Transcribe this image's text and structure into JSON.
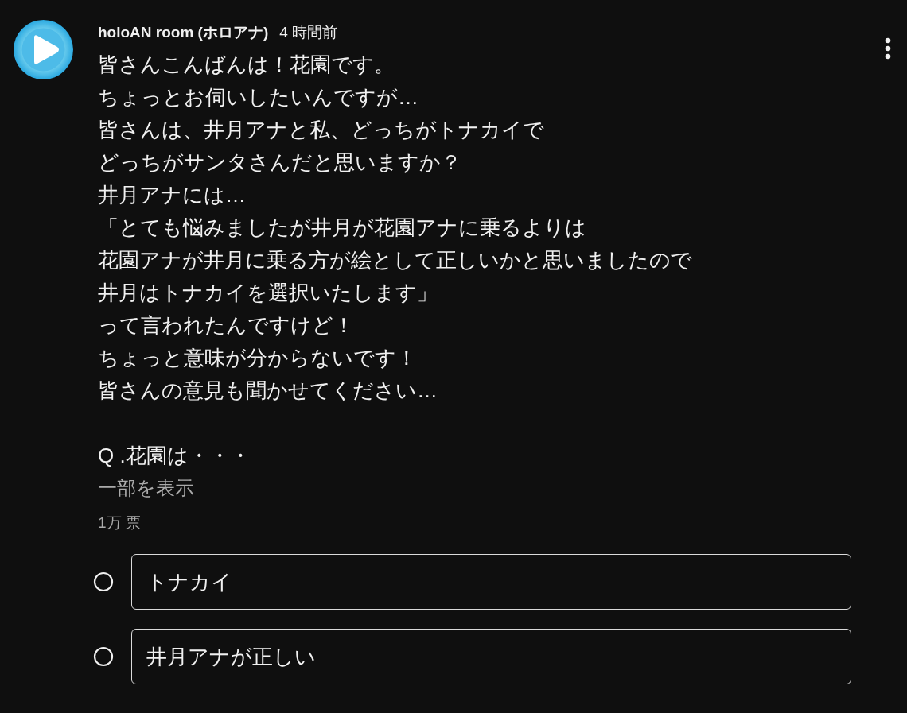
{
  "post": {
    "author": "holoAN room (ホロアナ)",
    "time": "4 時間前",
    "body": [
      "皆さんこんばんは！花園です。",
      "ちょっとお伺いしたいんですが…",
      "皆さんは、井月アナと私、どっちがトナカイで",
      "どっちがサンタさんだと思いますか？",
      "井月アナには…",
      "「とても悩みましたが井月が花園アナに乗るよりは",
      "花園アナが井月に乗る方が絵として正しいかと思いましたので",
      "井月はトナカイを選択いたします」",
      "って言われたんですけど！",
      "ちょっと意味が分からないです！",
      "皆さんの意見も聞かせてください…"
    ],
    "question": "Q .花園は・・・",
    "show_more": "一部を表示",
    "votes": "1万 票",
    "options": [
      {
        "label": "トナカイ",
        "selected": false
      },
      {
        "label": "井月アナが正しい",
        "selected": false
      }
    ]
  }
}
